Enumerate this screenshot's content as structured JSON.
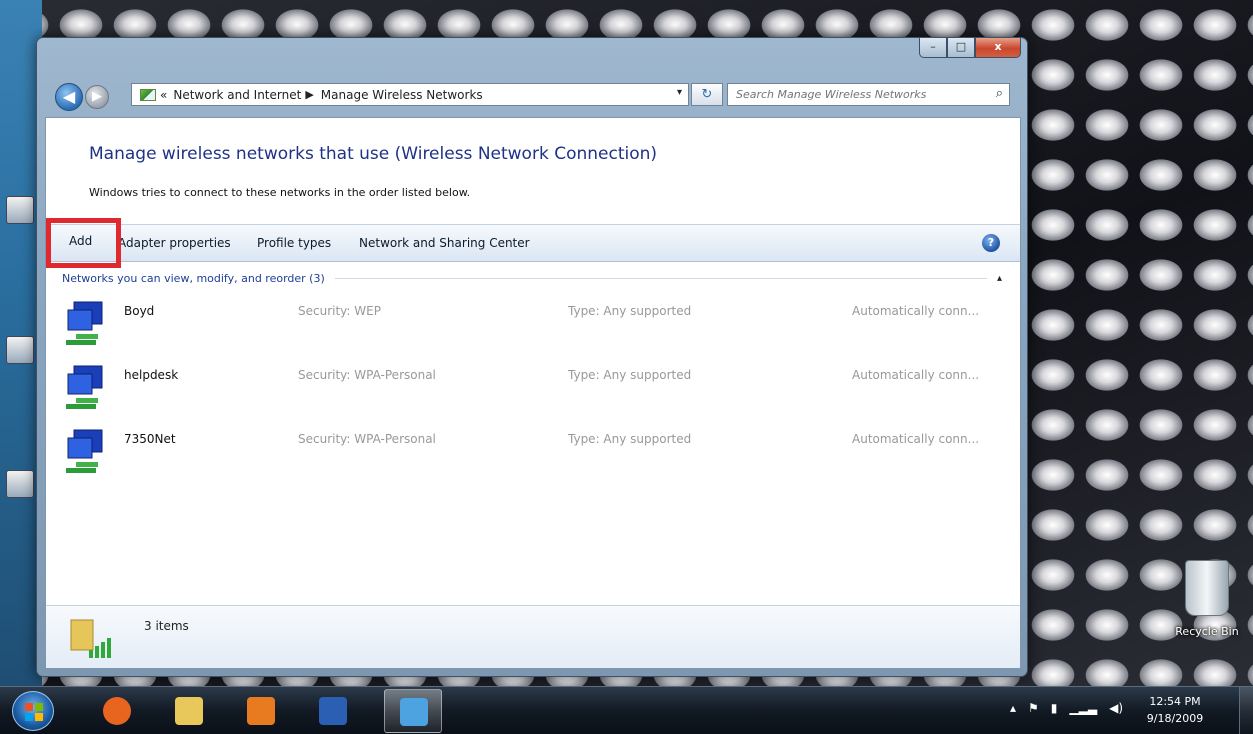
{
  "window": {
    "caption_buttons": {
      "minimize": "–",
      "maximize": "□",
      "close": "x"
    }
  },
  "navigation": {
    "back_glyph": "◀",
    "forward_glyph": "▶",
    "history_glyph": "▾",
    "breadcrumb": [
      {
        "label": "«"
      },
      {
        "label": "Network and Internet"
      },
      {
        "label": "Manage Wireless Networks"
      }
    ],
    "separator_glyph": "▶",
    "dropdown_glyph": "▾",
    "refresh_glyph": "↻",
    "search_placeholder": "Search Manage Wireless Networks",
    "search_icon_glyph": "⌕"
  },
  "page": {
    "title": "Manage wireless networks that use (Wireless Network Connection)",
    "description": "Windows tries to connect to these networks in the order listed below."
  },
  "commands": {
    "add": "Add",
    "adapter_properties": "Adapter properties",
    "profile_types": "Profile types",
    "network_sharing_center": "Network and Sharing Center",
    "help": "?"
  },
  "group": {
    "header": "Networks you can view, modify, and reorder (3)",
    "collapse_glyph": "▴"
  },
  "networks": [
    {
      "name": "Boyd",
      "security": "Security: WEP",
      "type": "Type: Any supported",
      "mode": "Automatically conn..."
    },
    {
      "name": "helpdesk",
      "security": "Security: WPA-Personal",
      "type": "Type: Any supported",
      "mode": "Automatically conn..."
    },
    {
      "name": "7350Net",
      "security": "Security: WPA-Personal",
      "type": "Type: Any supported",
      "mode": "Automatically conn..."
    }
  ],
  "details": {
    "count": "3 items"
  },
  "desktop": {
    "recycle_bin_label": "Recycle Bin"
  },
  "taskbar": {
    "apps": [
      {
        "name": "firefox",
        "color": "#e8651f"
      },
      {
        "name": "windows-explorer",
        "color": "#e8c85a"
      },
      {
        "name": "media-player",
        "color": "#e87a1f"
      },
      {
        "name": "microsoft-word",
        "color": "#2b5fb4"
      },
      {
        "name": "control-panel",
        "color": "#4da2e0"
      }
    ],
    "tray_glyphs": [
      "▴",
      "⚑",
      "▮",
      "▁▂▃",
      "◀)"
    ],
    "time": "12:54 PM",
    "date": "9/18/2009"
  },
  "colors": {
    "accent_red_highlight": "#e0282f",
    "title_blue": "#1e3287",
    "link_blue": "#1e3f97"
  }
}
